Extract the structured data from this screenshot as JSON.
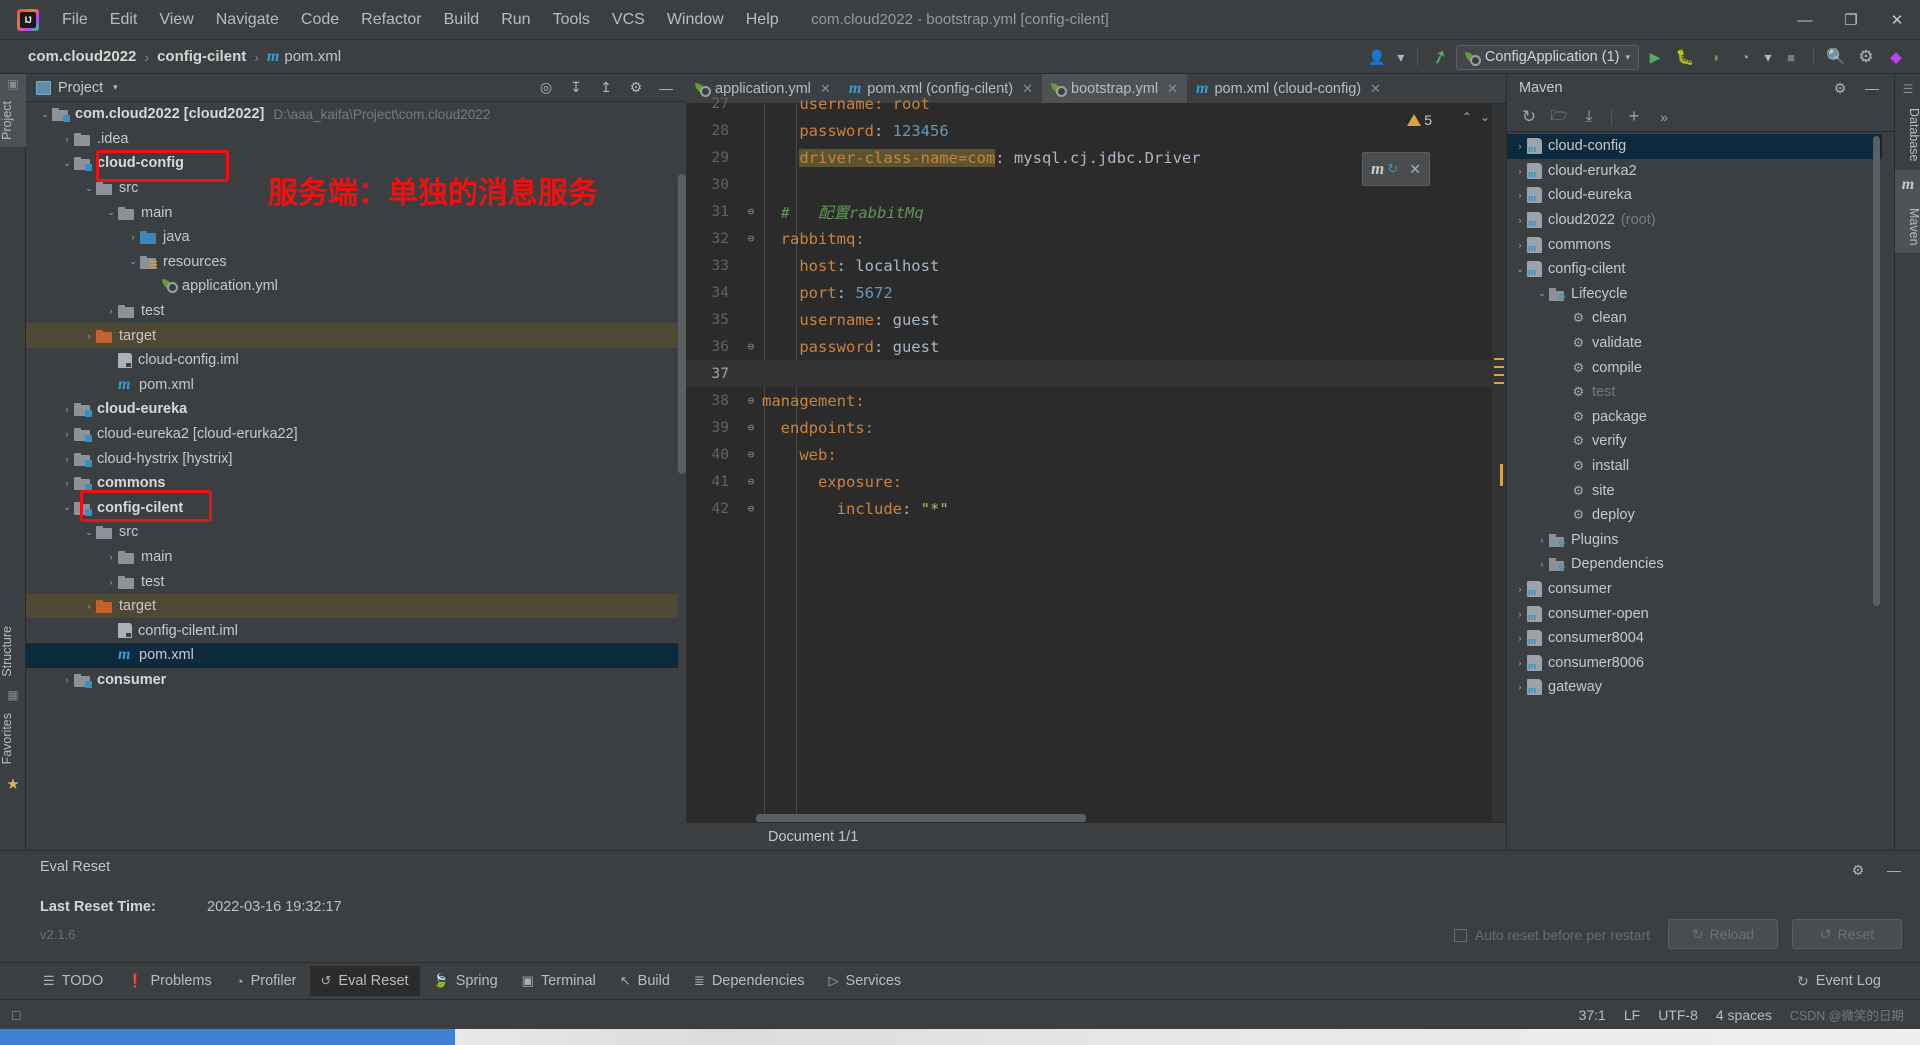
{
  "window": {
    "title": "com.cloud2022 - bootstrap.yml [config-cilent]",
    "minimize": "—",
    "maximize": "❐",
    "close": "✕"
  },
  "menubar": {
    "items": [
      {
        "label": "File"
      },
      {
        "label": "Edit"
      },
      {
        "label": "View"
      },
      {
        "label": "Navigate"
      },
      {
        "label": "Code"
      },
      {
        "label": "Refactor"
      },
      {
        "label": "Build"
      },
      {
        "label": "Run"
      },
      {
        "label": "Tools"
      },
      {
        "label": "VCS"
      },
      {
        "label": "Window"
      },
      {
        "label": "Help"
      }
    ]
  },
  "navbar": {
    "crumbs": [
      {
        "label": "com.cloud2022"
      },
      {
        "label": "config-cilent"
      },
      {
        "label": "pom.xml"
      }
    ],
    "separator": "›",
    "run_config": "ConfigApplication (1)",
    "icons": {
      "user": "👤",
      "hammer": "↖",
      "run": "▶",
      "debug": "🐞",
      "coverage": "◑",
      "profile": "◔",
      "stop": "■",
      "search": "🔍",
      "settings": "⚙",
      "plugin": "◆",
      "dropdown": "▾"
    }
  },
  "left_rail": {
    "project_label": "Project",
    "structure_label": "Structure",
    "favorites_label": "Favorites",
    "star_icon": "★"
  },
  "project_panel": {
    "title": "Project",
    "caret": "▾",
    "toolbar_icons": [
      "target-icon",
      "collapse-icon",
      "expand-icon",
      "settings-icon",
      "hide-icon"
    ],
    "tree": [
      {
        "depth": 0,
        "arrow": "⌄",
        "icon": "module-folder",
        "label": "com.cloud2022 [cloud2022]",
        "bold": true,
        "path": "D:\\aaa_kaifa\\Project\\com.cloud2022"
      },
      {
        "depth": 1,
        "arrow": "›",
        "icon": "folder",
        "label": ".idea"
      },
      {
        "depth": 1,
        "arrow": "⌄",
        "icon": "module-folder",
        "label": "cloud-config",
        "bold": true
      },
      {
        "depth": 2,
        "arrow": "⌄",
        "icon": "folder",
        "label": "src"
      },
      {
        "depth": 3,
        "arrow": "⌄",
        "icon": "folder",
        "label": "main"
      },
      {
        "depth": 4,
        "arrow": "›",
        "icon": "folder-blue",
        "label": "java"
      },
      {
        "depth": 4,
        "arrow": "⌄",
        "icon": "folder-resources",
        "label": "resources"
      },
      {
        "depth": 5,
        "arrow": "",
        "icon": "yml",
        "label": "application.yml"
      },
      {
        "depth": 3,
        "arrow": "›",
        "icon": "folder",
        "label": "test"
      },
      {
        "depth": 2,
        "arrow": "›",
        "icon": "folder-orange",
        "label": "target",
        "state": "target-highlight"
      },
      {
        "depth": 3,
        "arrow": "",
        "icon": "iml",
        "label": "cloud-config.iml"
      },
      {
        "depth": 3,
        "arrow": "",
        "icon": "maven",
        "label": "pom.xml"
      },
      {
        "depth": 1,
        "arrow": "›",
        "icon": "module-folder",
        "label": "cloud-eureka",
        "bold": true
      },
      {
        "depth": 1,
        "arrow": "›",
        "icon": "module-folder",
        "label": "cloud-eureka2 [cloud-erurka22]"
      },
      {
        "depth": 1,
        "arrow": "›",
        "icon": "module-folder",
        "label": "cloud-hystrix [hystrix]"
      },
      {
        "depth": 1,
        "arrow": "›",
        "icon": "module-folder",
        "label": "commons",
        "bold": true
      },
      {
        "depth": 1,
        "arrow": "⌄",
        "icon": "module-folder",
        "label": "config-cilent",
        "bold": true
      },
      {
        "depth": 2,
        "arrow": "⌄",
        "icon": "folder",
        "label": "src"
      },
      {
        "depth": 3,
        "arrow": "›",
        "icon": "folder",
        "label": "main"
      },
      {
        "depth": 3,
        "arrow": "›",
        "icon": "folder",
        "label": "test"
      },
      {
        "depth": 2,
        "arrow": "›",
        "icon": "folder-orange",
        "label": "target",
        "state": "target-highlight"
      },
      {
        "depth": 3,
        "arrow": "",
        "icon": "iml",
        "label": "config-cilent.iml"
      },
      {
        "depth": 3,
        "arrow": "",
        "icon": "maven",
        "label": "pom.xml",
        "state": "selected"
      },
      {
        "depth": 1,
        "arrow": "›",
        "icon": "module-folder",
        "label": "consumer",
        "bold": true
      }
    ]
  },
  "editor": {
    "tabs": [
      {
        "label": "application.yml",
        "icon": "yml-icon",
        "active": false,
        "close": "✕"
      },
      {
        "label": "pom.xml (config-cilent)",
        "icon": "maven-icon",
        "active": false,
        "close": "✕"
      },
      {
        "label": "bootstrap.yml",
        "icon": "yml-icon",
        "active": true,
        "close": "✕"
      },
      {
        "label": "pom.xml (cloud-config)",
        "icon": "maven-icon",
        "active": false,
        "close": "✕"
      }
    ],
    "warning_count": "5",
    "warning_icon": "⚠",
    "nav_up": "⌃",
    "nav_down": "⌄",
    "maven_popup": {
      "m": "m",
      "sync": "↻",
      "close": "✕"
    },
    "lines": [
      {
        "num": "27",
        "fold": "",
        "partial": true,
        "segments": [
          {
            "t": "    username: root",
            "c": "k"
          }
        ]
      },
      {
        "num": "28",
        "fold": "",
        "segments": [
          {
            "t": "    password",
            "c": "k"
          },
          {
            "t": ": ",
            "c": ""
          },
          {
            "t": "123456",
            "c": "num"
          }
        ]
      },
      {
        "num": "29",
        "fold": "",
        "segments": [
          {
            "t": "    ",
            "c": ""
          },
          {
            "t": "driver-class-name=com",
            "c": "k hl"
          },
          {
            "t": ": mysql.cj.jdbc.Driver",
            "c": ""
          }
        ]
      },
      {
        "num": "30",
        "fold": "",
        "segments": []
      },
      {
        "num": "31",
        "fold": "⊖",
        "segments": [
          {
            "t": "  #   ",
            "c": "cmt"
          },
          {
            "t": "配置rabbitMq",
            "c": "cmt"
          }
        ]
      },
      {
        "num": "32",
        "fold": "⊖",
        "segments": [
          {
            "t": "  rabbitmq:",
            "c": "k"
          }
        ]
      },
      {
        "num": "33",
        "fold": "",
        "segments": [
          {
            "t": "    host",
            "c": "k"
          },
          {
            "t": ": localhost",
            "c": ""
          }
        ]
      },
      {
        "num": "34",
        "fold": "",
        "segments": [
          {
            "t": "    port",
            "c": "k"
          },
          {
            "t": ": ",
            "c": ""
          },
          {
            "t": "5672",
            "c": "num"
          }
        ]
      },
      {
        "num": "35",
        "fold": "",
        "segments": [
          {
            "t": "    username",
            "c": "k"
          },
          {
            "t": ": guest",
            "c": ""
          }
        ]
      },
      {
        "num": "36",
        "fold": "⊖",
        "segments": [
          {
            "t": "    password",
            "c": "k"
          },
          {
            "t": ": guest",
            "c": ""
          }
        ]
      },
      {
        "num": "37",
        "fold": "",
        "cursor": true,
        "segments": []
      },
      {
        "num": "38",
        "fold": "⊖",
        "segments": [
          {
            "t": "management:",
            "c": "k"
          }
        ]
      },
      {
        "num": "39",
        "fold": "⊖",
        "segments": [
          {
            "t": "  endpoints:",
            "c": "k"
          }
        ]
      },
      {
        "num": "40",
        "fold": "⊖",
        "segments": [
          {
            "t": "    web:",
            "c": "k"
          }
        ]
      },
      {
        "num": "41",
        "fold": "⊖",
        "segments": [
          {
            "t": "      exposure:",
            "c": "k"
          }
        ]
      },
      {
        "num": "42",
        "fold": "⊖",
        "segments": [
          {
            "t": "        include",
            "c": "k"
          },
          {
            "t": ": ",
            "c": ""
          },
          {
            "t": "\"*\"",
            "c": "str"
          }
        ]
      }
    ],
    "document_status": "Document 1/1"
  },
  "maven_panel": {
    "title": "Maven",
    "head_icons": {
      "settings": "⚙",
      "hide": "—"
    },
    "toolbar_icons": {
      "refresh": "↻",
      "add_folder": "🗀",
      "download": "⤓",
      "add": "+",
      "more": "»"
    },
    "tree": [
      {
        "depth": 0,
        "arrow": "›",
        "icon": "maven-project",
        "label": "cloud-config",
        "state": "selected"
      },
      {
        "depth": 0,
        "arrow": "›",
        "icon": "maven-project",
        "label": "cloud-erurka2"
      },
      {
        "depth": 0,
        "arrow": "›",
        "icon": "maven-project",
        "label": "cloud-eureka"
      },
      {
        "depth": 0,
        "arrow": "›",
        "icon": "maven-project",
        "label": "cloud2022",
        "sub": "(root)"
      },
      {
        "depth": 0,
        "arrow": "›",
        "icon": "maven-project",
        "label": "commons"
      },
      {
        "depth": 0,
        "arrow": "⌄",
        "icon": "maven-project",
        "label": "config-cilent"
      },
      {
        "depth": 1,
        "arrow": "⌄",
        "icon": "lifecycle-folder",
        "label": "Lifecycle"
      },
      {
        "depth": 2,
        "arrow": "",
        "icon": "goal",
        "label": "clean"
      },
      {
        "depth": 2,
        "arrow": "",
        "icon": "goal",
        "label": "validate"
      },
      {
        "depth": 2,
        "arrow": "",
        "icon": "goal",
        "label": "compile"
      },
      {
        "depth": 2,
        "arrow": "",
        "icon": "goal",
        "label": "test",
        "dim": true
      },
      {
        "depth": 2,
        "arrow": "",
        "icon": "goal",
        "label": "package"
      },
      {
        "depth": 2,
        "arrow": "",
        "icon": "goal",
        "label": "verify"
      },
      {
        "depth": 2,
        "arrow": "",
        "icon": "goal",
        "label": "install"
      },
      {
        "depth": 2,
        "arrow": "",
        "icon": "goal",
        "label": "site"
      },
      {
        "depth": 2,
        "arrow": "",
        "icon": "goal",
        "label": "deploy"
      },
      {
        "depth": 1,
        "arrow": "›",
        "icon": "lifecycle-folder",
        "label": "Plugins"
      },
      {
        "depth": 1,
        "arrow": "›",
        "icon": "deps-folder",
        "label": "Dependencies"
      },
      {
        "depth": 0,
        "arrow": "›",
        "icon": "maven-project",
        "label": "consumer"
      },
      {
        "depth": 0,
        "arrow": "›",
        "icon": "maven-project",
        "label": "consumer-open"
      },
      {
        "depth": 0,
        "arrow": "›",
        "icon": "maven-project",
        "label": "consumer8004"
      },
      {
        "depth": 0,
        "arrow": "›",
        "icon": "maven-project",
        "label": "consumer8006"
      },
      {
        "depth": 0,
        "arrow": "›",
        "icon": "maven-project",
        "label": "gateway"
      }
    ]
  },
  "right_rail": {
    "database_label": "Database",
    "maven_label": "Maven",
    "maven_m": "m"
  },
  "bottom_window": {
    "title": "Eval Reset",
    "settings_icon": "⚙",
    "hide_icon": "—",
    "reset_label": "Last Reset Time:",
    "reset_time": "2022-03-16 19:32:17",
    "version": "v2.1.6",
    "auto_reset_label": "Auto reset before per restart",
    "reload_button": "Reload",
    "reload_icon": "↻",
    "reset_button": "Reset",
    "reset_icon": "↺"
  },
  "tool_tabs": {
    "items": [
      {
        "label": "TODO",
        "icon": "☰",
        "active": false
      },
      {
        "label": "Problems",
        "icon": "❗",
        "active": false
      },
      {
        "label": "Profiler",
        "icon": "◔",
        "active": false
      },
      {
        "label": "Eval Reset",
        "icon": "↺",
        "active": true
      },
      {
        "label": "Spring",
        "icon": "🍃",
        "active": false
      },
      {
        "label": "Terminal",
        "icon": "▣",
        "active": false
      },
      {
        "label": "Build",
        "icon": "↖",
        "active": false
      },
      {
        "label": "Dependencies",
        "icon": "≣",
        "active": false
      },
      {
        "label": "Services",
        "icon": "▷",
        "active": false
      }
    ],
    "event_log": {
      "label": "Event Log",
      "icon": "↻"
    }
  },
  "statusbar": {
    "left_icon": "□",
    "caret_position": "37:1",
    "line_separator": "LF",
    "encoding": "UTF-8",
    "indent": "4 spaces",
    "watermark": "CSDN @微笑的日期"
  },
  "annotations": {
    "note_text": "服务端：单独的消息服务",
    "box_color": "#ee1111"
  }
}
